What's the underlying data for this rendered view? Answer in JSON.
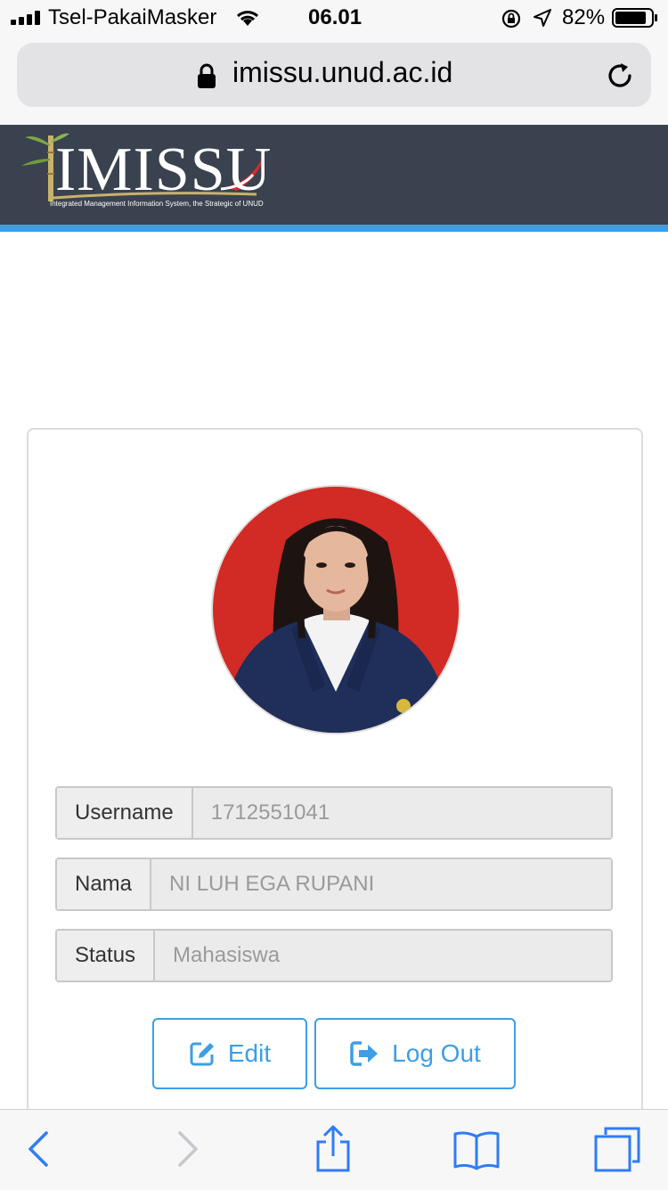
{
  "status_bar": {
    "carrier": "Tsel-PakaiMasker",
    "time": "06.01",
    "battery_percent": "82%"
  },
  "browser": {
    "url": "imissu.unud.ac.id"
  },
  "site": {
    "logo_text": "IMISSU",
    "tagline": "Integrated Management Information System, the Strategic of UNUD"
  },
  "profile": {
    "fields": [
      {
        "label": "Username",
        "value": "1712551041"
      },
      {
        "label": "Nama",
        "value": "NI LUH EGA RUPANI"
      },
      {
        "label": "Status",
        "value": "Mahasiswa"
      }
    ],
    "edit_label": "Edit",
    "logout_label": "Log Out"
  },
  "colors": {
    "accent": "#3d9ee5",
    "header_bg": "#3a4250"
  }
}
